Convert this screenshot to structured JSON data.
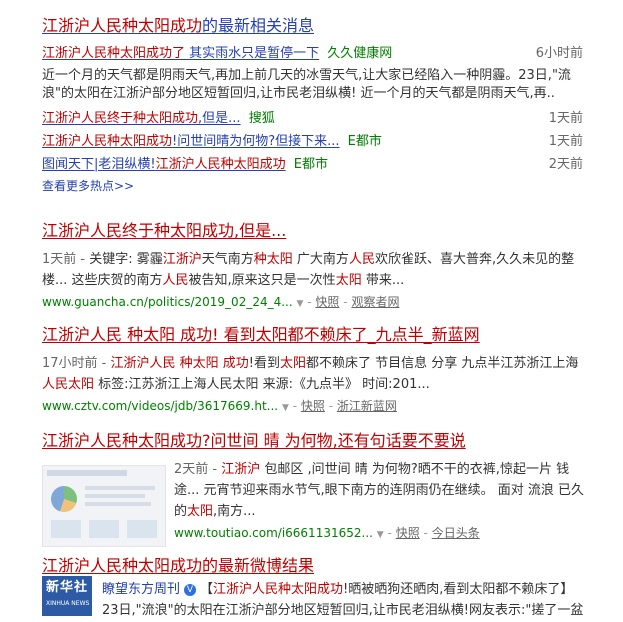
{
  "news": {
    "title_hl": "江浙沪人民种太阳成功",
    "title_rest": "的最新相关消息",
    "top": {
      "title_hl": "江浙沪人民种太阳成功了",
      "title_rest": " 其实雨水只是暂停一下",
      "source": "久久健康网",
      "time": "6小时前",
      "abstract": "近一个月的天气都是阴雨天气,再加上前几天的冰雪天气,让大家已经陷入一种阴霾。23日,\"流浪\"的太阳在江浙沪部分地区短暂回归,让市民老泪纵横! 近一个月的天气都是阴雨天气,再.."
    },
    "items": [
      {
        "hl": "江浙沪人民终于种太阳成功",
        "rest": ",但是...",
        "source": "搜狐",
        "time": "1天前"
      },
      {
        "hl": "江浙沪人民种太阳成功",
        "rest": "!问世间晴为何物?但接下来...",
        "source": "E都市",
        "time": "1天前"
      },
      {
        "hl_pre": "图闻天下|老泪纵横!",
        "hl": "江浙沪人民种太阳成功",
        "rest": "",
        "source": "E都市",
        "time": "2天前"
      }
    ],
    "more": "查看更多热点>>"
  },
  "results": [
    {
      "title": "江浙沪人民终于种太阳成功,但是...",
      "date": "1天前 - ",
      "keyword_label": "关键字: 雾霾",
      "abs_1": "江浙沪",
      "abs_2": "天气南方",
      "abs_3": "种太阳",
      "abs_4": " 广大南方",
      "abs_5": "人民",
      "abs_6": "欢欣雀跃、喜大普奔,久久未见的整楼... 这些庆贺的南方",
      "abs_7": "人民",
      "abs_8": "被告知,原来这只是一次性",
      "abs_9": "太阳",
      "abs_10": " 带来...",
      "url": "www.guancha.cn/politics/2019_02_24_4...",
      "snapshot": "快照",
      "site": "观察者网"
    },
    {
      "title": "江浙沪人民 种太阳 成功! 看到太阳都不赖床了_九点半_新蓝网",
      "date": "17小时前 - ",
      "abs_1": "江浙沪人民 种太阳 成功",
      "abs_2": "!看到",
      "abs_3": "太阳",
      "abs_4": "都不赖床了 节目信息 分享 九点半江苏浙江上海",
      "abs_5": "人民太阳",
      "abs_6": " 标签:江苏浙江上海人民太阳 来源:《九点半》 时间:201...",
      "url": "www.cztv.com/videos/jdb/3617669.ht...",
      "snapshot": "快照",
      "site": "浙江新蓝网"
    },
    {
      "title": "江浙沪人民种太阳成功?问世间 晴 为何物,还有句话要不要说",
      "date": "2天前 - ",
      "abs_1": "江浙沪",
      "abs_2": " 包邮区 ,问世间 晴 为何物?晒不干的衣裤,惊起一片 钱途... 元宵节迎来雨水节气,眼下南方的连阴雨仍在继续。 面对 流浪 已久的",
      "abs_3": "太阳",
      "abs_4": ",南方...",
      "url": "www.toutiao.com/i6661131652...",
      "snapshot": "快照",
      "site": "今日头条"
    },
    {
      "title": "江浙沪人民种太阳成功的最新微博结果",
      "account": "瞭望东方周刊",
      "tweet_pre": "【",
      "tweet_hl": "江浙沪人民种太阳成功",
      "tweet_rest": "!晒被晒狗还晒肉,看到太阳都不赖床了】",
      "tweet_line2": "23日,\"流浪\"的太阳在江浙沪部分地区短暂回归,让市民老泪纵横!网友表示:\"搓了一盆",
      "logo_big": "新华社",
      "logo_small": "XINHUA NEWS"
    }
  ],
  "colors": {
    "link": "#2440b3",
    "highlight": "#c00000",
    "url_green": "#008000",
    "gray": "#666666"
  },
  "icons": {
    "verified": "verified-v-icon",
    "arrow": "dropdown-arrow-icon"
  }
}
